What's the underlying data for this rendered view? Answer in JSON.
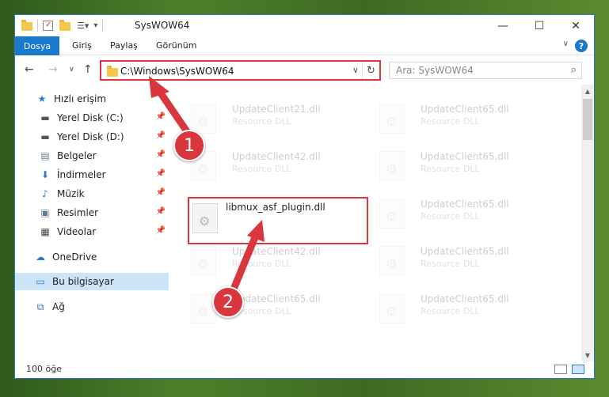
{
  "window": {
    "title": "SysWOW64",
    "controls": {
      "minimize": "—",
      "maximize": "☐",
      "close": "✕"
    }
  },
  "ribbon": {
    "tabs": [
      "Dosya",
      "Giriş",
      "Paylaş",
      "Görünüm"
    ],
    "help": "?"
  },
  "navigation": {
    "address": "C:\\Windows\\SysWOW64",
    "search_placeholder": "Ara: SysWOW64"
  },
  "sidebar": {
    "items": [
      {
        "label": "Hızlı erişim",
        "icon": "star-icon"
      },
      {
        "label": "Yerel Disk (C:)",
        "icon": "drive-icon",
        "pinned": true
      },
      {
        "label": "Yerel Disk (D:)",
        "icon": "drive-icon",
        "pinned": true
      },
      {
        "label": "Belgeler",
        "icon": "documents-icon",
        "pinned": true
      },
      {
        "label": "İndirmeler",
        "icon": "download-icon",
        "pinned": true
      },
      {
        "label": "Müzik",
        "icon": "music-icon",
        "pinned": true
      },
      {
        "label": "Resimler",
        "icon": "pictures-icon",
        "pinned": true
      },
      {
        "label": "Videolar",
        "icon": "video-icon",
        "pinned": true
      },
      {
        "label": "OneDrive",
        "icon": "cloud-icon"
      },
      {
        "label": "Bu bilgisayar",
        "icon": "computer-icon",
        "selected": true
      },
      {
        "label": "Ağ",
        "icon": "network-icon"
      }
    ]
  },
  "files": [
    {
      "name": "UpdateClient21.dll",
      "type": "Resource DLL"
    },
    {
      "name": "UpdateClient65.dll",
      "type": "Resource DLL"
    },
    {
      "name": "UpdateClient42.dll",
      "type": "Resource DLL"
    },
    {
      "name": "UpdateClient65.dll",
      "type": "Resource DLL"
    },
    {
      "name": "libmux_asf_plugin.dll",
      "type": ""
    },
    {
      "name": "UpdateClient65.dll",
      "type": "Resource DLL"
    },
    {
      "name": "UpdateClient42.dll",
      "type": "Resource DLL"
    },
    {
      "name": "UpdateClient65.dll",
      "type": "Resource DLL"
    },
    {
      "name": "UpdateClient65.dll",
      "type": "Resource DLL"
    },
    {
      "name": "UpdateClient65.dll",
      "type": "Resource DLL"
    }
  ],
  "status": {
    "count": "100 öğe"
  },
  "annotations": {
    "step1": "1",
    "step2": "2"
  },
  "colors": {
    "accent": "#1979ca",
    "highlight": "#d9363e",
    "selected": "#cce4f7"
  }
}
